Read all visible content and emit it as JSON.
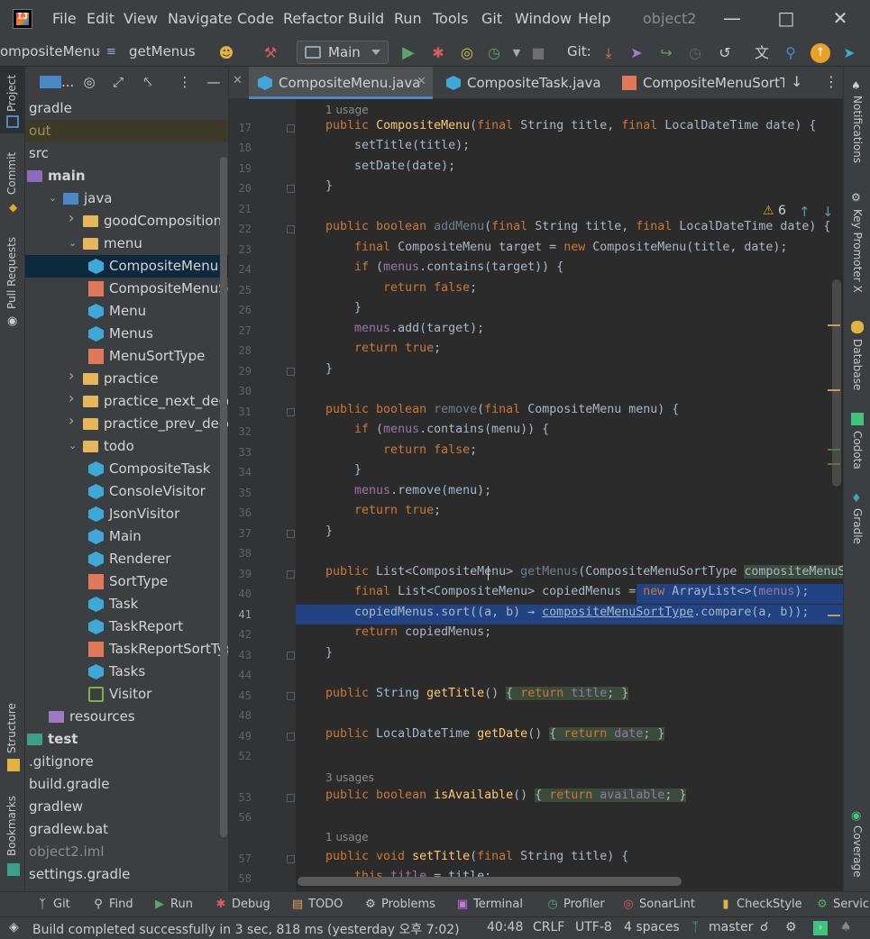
{
  "menu": {
    "items": [
      "File",
      "Edit",
      "View",
      "Navigate",
      "Code",
      "Refactor",
      "Build",
      "Run",
      "Tools",
      "Git",
      "Window",
      "Help"
    ],
    "window_title": "object2"
  },
  "toolbar": {
    "breadcrumb_class": "ompositeMenu",
    "breadcrumb_method": "getMenus",
    "run_config": "Main",
    "git_label": "Git:"
  },
  "left_strip": {
    "project": "Project",
    "commit": "Commit",
    "pull_requests": "Pull Requests",
    "structure": "Structure",
    "bookmarks": "Bookmarks"
  },
  "right_strip": {
    "notifications": "Notifications",
    "key_promoter": "Key Promoter X",
    "database": "Database",
    "codota": "Codota",
    "gradle": "Gradle",
    "coverage": "Coverage"
  },
  "project_header": {
    "ellipsis": "..."
  },
  "tree": [
    {
      "label": "gradle",
      "indent": 0,
      "icon": "none",
      "style": "normal"
    },
    {
      "label": "out",
      "indent": 0,
      "icon": "none",
      "style": "olive"
    },
    {
      "label": "src",
      "indent": 0,
      "icon": "none",
      "style": "normal"
    },
    {
      "label": "main",
      "indent": 0,
      "icon": "src-folder",
      "style": "bold"
    },
    {
      "label": "java",
      "indent": 1,
      "icon": "blue-folder",
      "style": "normal",
      "arrow": "down"
    },
    {
      "label": "goodComposition",
      "indent": 2,
      "icon": "folder",
      "style": "normal",
      "arrow": "right"
    },
    {
      "label": "menu",
      "indent": 2,
      "icon": "folder",
      "style": "normal",
      "arrow": "down"
    },
    {
      "label": "CompositeMenu",
      "indent": 3,
      "icon": "class",
      "style": "normal",
      "selected": true
    },
    {
      "label": "CompositeMenuSortType",
      "indent": 3,
      "icon": "enum",
      "style": "normal"
    },
    {
      "label": "Menu",
      "indent": 3,
      "icon": "class",
      "style": "normal"
    },
    {
      "label": "Menus",
      "indent": 3,
      "icon": "class",
      "style": "normal"
    },
    {
      "label": "MenuSortType",
      "indent": 3,
      "icon": "enum",
      "style": "normal"
    },
    {
      "label": "practice",
      "indent": 2,
      "icon": "folder",
      "style": "normal",
      "arrow": "right"
    },
    {
      "label": "practice_next_deco_for_",
      "indent": 2,
      "icon": "folder",
      "style": "normal",
      "arrow": "right"
    },
    {
      "label": "practice_prev_deco_for_",
      "indent": 2,
      "icon": "folder",
      "style": "normal",
      "arrow": "right"
    },
    {
      "label": "todo",
      "indent": 2,
      "icon": "folder",
      "style": "normal",
      "arrow": "down"
    },
    {
      "label": "CompositeTask",
      "indent": 3,
      "icon": "class",
      "style": "normal"
    },
    {
      "label": "ConsoleVisitor",
      "indent": 3,
      "icon": "class",
      "style": "normal"
    },
    {
      "label": "JsonVisitor",
      "indent": 3,
      "icon": "class",
      "style": "normal"
    },
    {
      "label": "Main",
      "indent": 3,
      "icon": "class",
      "style": "normal"
    },
    {
      "label": "Renderer",
      "indent": 3,
      "icon": "class",
      "style": "normal"
    },
    {
      "label": "SortType",
      "indent": 3,
      "icon": "enum",
      "style": "normal"
    },
    {
      "label": "Task",
      "indent": 3,
      "icon": "class",
      "style": "normal"
    },
    {
      "label": "TaskReport",
      "indent": 3,
      "icon": "class",
      "style": "normal"
    },
    {
      "label": "TaskReportSortType",
      "indent": 3,
      "icon": "enum",
      "style": "normal"
    },
    {
      "label": "Tasks",
      "indent": 3,
      "icon": "class",
      "style": "normal"
    },
    {
      "label": "Visitor",
      "indent": 3,
      "icon": "interface",
      "style": "normal"
    },
    {
      "label": "resources",
      "indent": 1,
      "icon": "res-folder",
      "style": "normal"
    },
    {
      "label": "test",
      "indent": 0,
      "icon": "test-folder",
      "style": "bold"
    },
    {
      "label": ".gitignore",
      "indent": 0,
      "icon": "none",
      "style": "normal"
    },
    {
      "label": "build.gradle",
      "indent": 0,
      "icon": "none",
      "style": "normal"
    },
    {
      "label": "gradlew",
      "indent": 0,
      "icon": "none",
      "style": "normal"
    },
    {
      "label": "gradlew.bat",
      "indent": 0,
      "icon": "none",
      "style": "normal"
    },
    {
      "label": "object2.iml",
      "indent": 0,
      "icon": "none",
      "style": "dim"
    },
    {
      "label": "settings.gradle",
      "indent": 0,
      "icon": "none",
      "style": "normal"
    }
  ],
  "tabs": [
    {
      "label": "CompositeMenu.java",
      "icon": "class",
      "active": true
    },
    {
      "label": "CompositeTask.java",
      "icon": "class",
      "active": false
    },
    {
      "label": "CompositeMenuSortTy",
      "icon": "enum",
      "active": false
    }
  ],
  "inspection": {
    "warning_count": "6"
  },
  "code_lines": [
    {
      "usage": "1 usage"
    },
    {
      "n": "17",
      "html": "<span class='kw'>public</span> <span class='fn'>CompositeMenu</span>(<span class='kw'>final</span> String title, <span class='kw'>final</span> LocalDateTime date) {"
    },
    {
      "n": "18",
      "html": "    setTitle(title);"
    },
    {
      "n": "19",
      "html": "    setDate(date);"
    },
    {
      "n": "20",
      "html": "}"
    },
    {
      "n": "21",
      "html": ""
    },
    {
      "n": "22",
      "html": "<span class='kw'>public boolean</span> <span class='unused'>addMenu</span>(<span class='kw'>final</span> String title, <span class='kw'>final</span> LocalDateTime date) {"
    },
    {
      "n": "23",
      "html": "    <span class='kw'>final</span> CompositeMenu target = <span class='kw'>new</span> CompositeMenu(title, date);"
    },
    {
      "n": "24",
      "html": "    <span class='kw'>if</span> (<span class='fld'>menus</span>.contains(target)) {"
    },
    {
      "n": "25",
      "html": "        <span class='kw'>return false</span>;"
    },
    {
      "n": "26",
      "html": "    }"
    },
    {
      "n": "27",
      "html": "    <span class='fld'>menus</span>.add(target);"
    },
    {
      "n": "28",
      "html": "    <span class='kw'>return true</span>;"
    },
    {
      "n": "29",
      "html": "}"
    },
    {
      "n": "30",
      "html": ""
    },
    {
      "n": "31",
      "html": "<span class='kw'>public boolean</span> <span class='unused'>remove</span>(<span class='kw'>final</span> CompositeMenu menu) {"
    },
    {
      "n": "32",
      "html": "    <span class='kw'>if</span> (<span class='fld'>menus</span>.contains(menu)) {"
    },
    {
      "n": "33",
      "html": "        <span class='kw'>return false</span>;"
    },
    {
      "n": "34",
      "html": "    }"
    },
    {
      "n": "35",
      "html": "    <span class='fld'>menus</span>.remove(menu);"
    },
    {
      "n": "36",
      "html": "    <span class='kw'>return true</span>;"
    },
    {
      "n": "37",
      "html": "}"
    },
    {
      "n": "38",
      "html": ""
    },
    {
      "n": "39",
      "html": "<span class='kw'>public</span> List&lt;CompositeMenu&gt; <span class='unused'>getMenus</span>(CompositeMenuSortType <span class='hint-bg'>compositeMenuS</span>"
    },
    {
      "n": "40",
      "html": "    <span class='kw'>final</span> List&lt;CompositeMenu&gt; copiedMenus = <span class='kw'>new</span> ArrayList&lt;&gt;(<span class='fld'>menus</span>);"
    },
    {
      "n": "41",
      "html": "    copiedMenus.sort((a, b) &#8594; <span style='text-decoration:underline'>compositeMenuSortType</span>.compare(a, b));"
    },
    {
      "n": "42",
      "html": "    <span class='kw'>return</span> copiedMenus;"
    },
    {
      "n": "43",
      "html": "}"
    },
    {
      "n": "44",
      "html": ""
    },
    {
      "n": "45",
      "html": "<span class='kw'>public</span> String <span class='fn'>getTitle</span>() <span class='hint-bg'>{ <span class='kw'>return</span> <span class='fld'>title</span>; }</span>"
    },
    {
      "n": "48",
      "html": ""
    },
    {
      "n": "49",
      "html": "<span class='kw'>public</span> LocalDateTime <span class='fn'>getDate</span>() <span class='hint-bg'>{ <span class='kw'>return</span> <span class='fld'>date</span>; }</span>"
    },
    {
      "n": "52",
      "html": ""
    },
    {
      "usage": "3 usages"
    },
    {
      "n": "53",
      "html": "<span class='kw'>public boolean</span> <span class='fn'>isAvailable</span>() <span class='hint-bg'>{ <span class='kw'>return</span> <span class='fld'>available</span>; }</span>"
    },
    {
      "n": "56",
      "html": ""
    },
    {
      "usage": "1 usage"
    },
    {
      "n": "57",
      "html": "<span class='kw'>public void</span> <span class='fn'>setTitle</span>(<span class='kw'>final</span> String title) {"
    },
    {
      "n": "58",
      "html": "    <span class='kw'>this</span>.<span class='fld'>title</span> = title;"
    }
  ],
  "bottom_tools": [
    {
      "label": "Git",
      "icon": "git-icon"
    },
    {
      "label": "Find",
      "icon": "search-icon"
    },
    {
      "label": "Run",
      "icon": "run-icon"
    },
    {
      "label": "Debug",
      "icon": "bug-icon"
    },
    {
      "label": "TODO",
      "icon": "todo-icon"
    },
    {
      "label": "Problems",
      "icon": "problems-icon"
    },
    {
      "label": "Terminal",
      "icon": "terminal-icon"
    },
    {
      "label": "Profiler",
      "icon": "profiler-icon"
    },
    {
      "label": "SonarLint",
      "icon": "sonarlint-icon"
    },
    {
      "label": "CheckStyle",
      "icon": "checkstyle-icon"
    },
    {
      "label": "Servic",
      "icon": "services-icon"
    }
  ],
  "status": {
    "message": "Build completed successfully in 3 sec, 818 ms (yesterday 오후 7:02)",
    "position": "40:48",
    "line_sep": "CRLF",
    "encoding": "UTF-8",
    "indent": "4 spaces",
    "branch": "master"
  },
  "colors": {
    "accent": "#4a88c7",
    "selection": "#214283",
    "keyword": "#cc7832",
    "method": "#ffc66d",
    "field": "#9876aa"
  }
}
